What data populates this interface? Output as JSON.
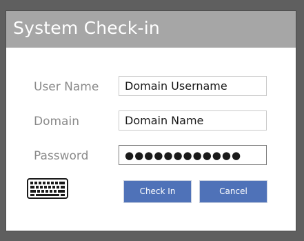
{
  "dialog": {
    "title": "System Check-in"
  },
  "form": {
    "username": {
      "label": "User Name",
      "value": "Domain Username"
    },
    "domain": {
      "label": "Domain",
      "value": "Domain Name"
    },
    "password": {
      "label": "Password",
      "value": "●●●●●●●●●●●●"
    }
  },
  "actions": {
    "keyboard_icon": "keyboard-icon",
    "checkin_label": "Check In",
    "cancel_label": "Cancel"
  },
  "colors": {
    "backdrop": "#5f5f5f",
    "title_bar": "#a6a6a6",
    "button": "#4f72b8",
    "label": "#8a8a8a"
  }
}
